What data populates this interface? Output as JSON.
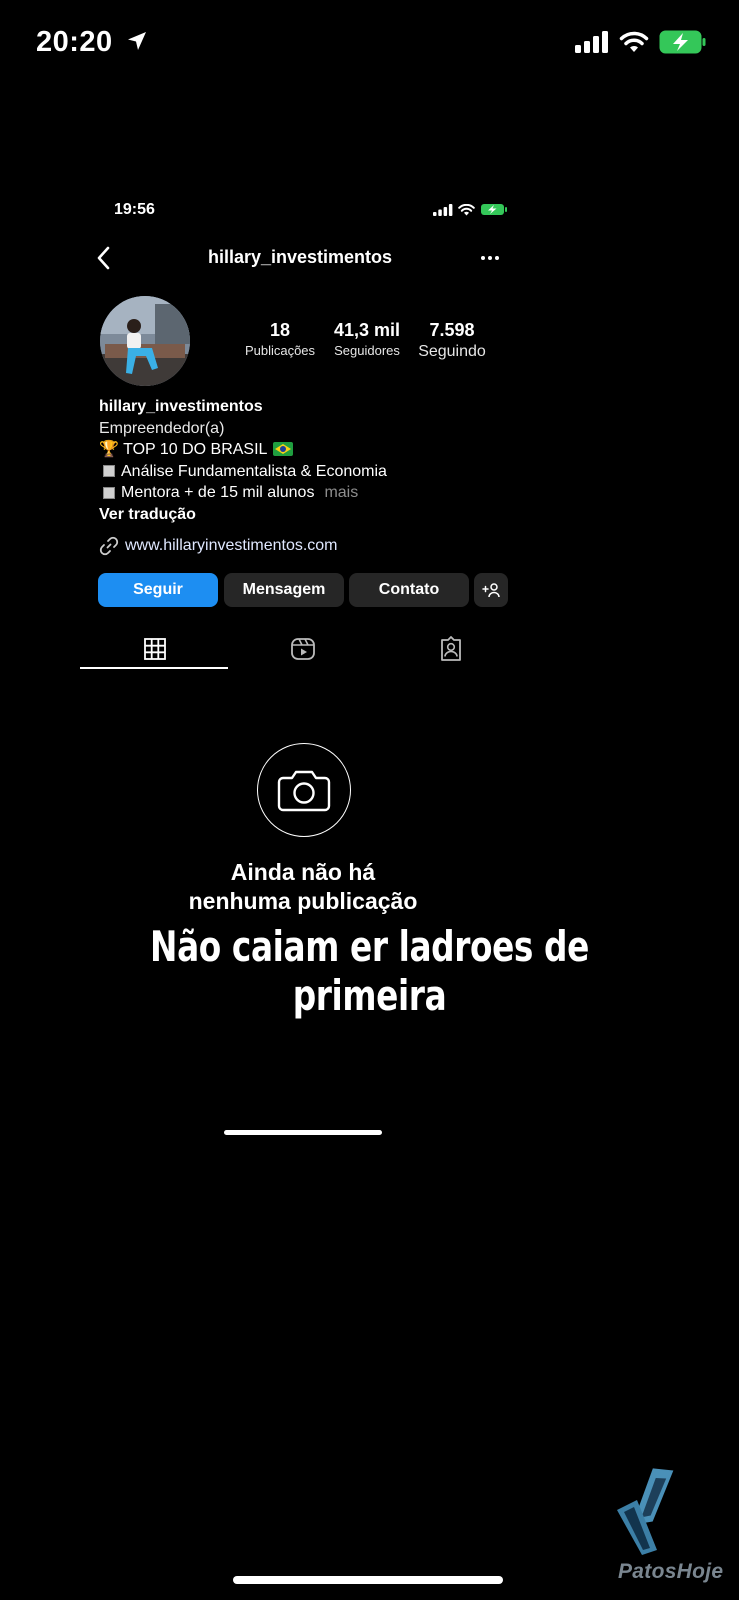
{
  "outer_status": {
    "time": "20:20"
  },
  "inner_status": {
    "time": "19:56"
  },
  "header": {
    "username": "hillary_investimentos"
  },
  "stats": [
    {
      "value": "18",
      "label": "Publicações"
    },
    {
      "value": "41,3 mil",
      "label": "Seguidores"
    },
    {
      "value": "7.598",
      "label": "Seguindo"
    }
  ],
  "bio": {
    "name": "hillary_investimentos",
    "category": "Empreendedor(a)",
    "line1": "🏆 TOP 10 DO BRASIL",
    "line2": "Análise Fundamentalista & Economia",
    "line3": "Mentora + de 15 mil alunos",
    "more_label": "mais",
    "translate_label": "Ver tradução"
  },
  "link": {
    "url": "www.hillaryinvestimentos.com"
  },
  "buttons": {
    "follow": "Seguir",
    "message": "Mensagem",
    "contact": "Contato",
    "add": "+ዶ"
  },
  "empty_state": {
    "title_line1": "Ainda não há",
    "title_line2": "nenhuma publicação"
  },
  "caption": "Não caiam er ladroes de primeira",
  "watermark": "PatosHoje",
  "colors": {
    "accent": "#1d8ef2",
    "battery": "#34c759",
    "button_dark": "#262626"
  },
  "icons": [
    "location-arrow-icon",
    "signal-icon",
    "wifi-icon",
    "battery-charging-icon",
    "chevron-left-icon",
    "more-icon",
    "link-icon",
    "add-person-icon",
    "grid-icon",
    "reels-icon",
    "tagged-icon",
    "camera-icon"
  ]
}
